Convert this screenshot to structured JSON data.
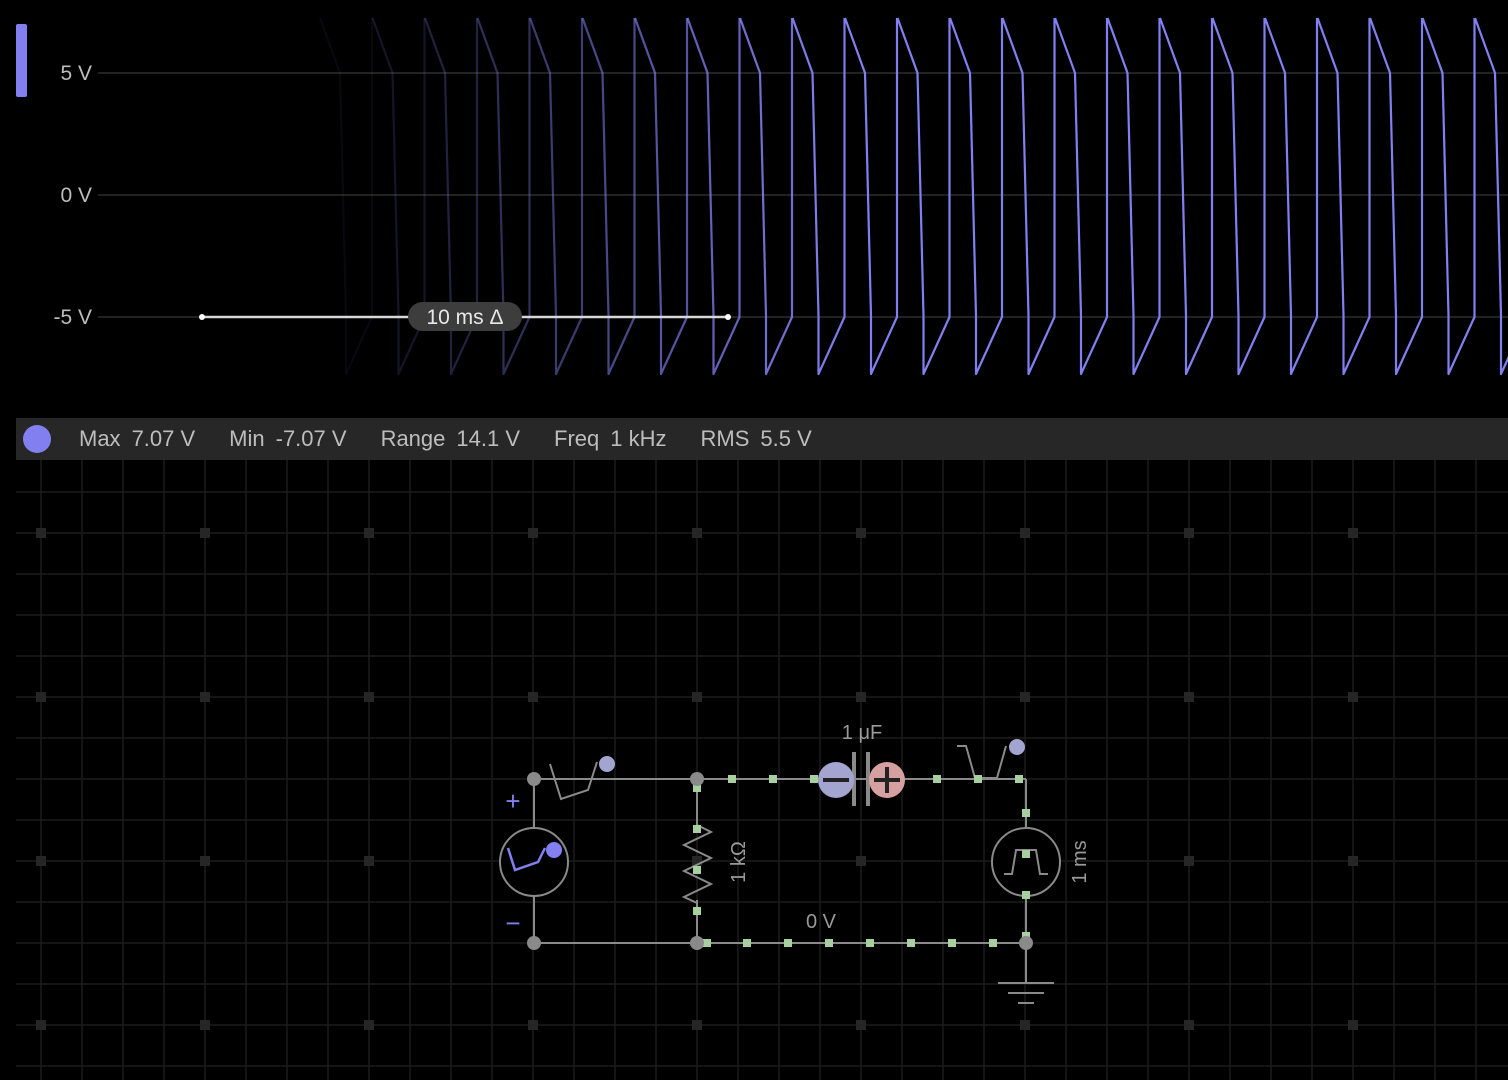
{
  "scope": {
    "y_axis": {
      "ticks": [
        "5 V",
        "0 V",
        "-5 V"
      ]
    },
    "time_marker": {
      "label": "10 ms Δ"
    },
    "trace_color": "#8280f0"
  },
  "stats": {
    "max": {
      "label": "Max",
      "value": "7.07 V"
    },
    "min": {
      "label": "Min",
      "value": "-7.07 V"
    },
    "range": {
      "label": "Range",
      "value": "14.1 V"
    },
    "freq": {
      "label": "Freq",
      "value": "1 kHz"
    },
    "rms": {
      "label": "RMS",
      "value": "5.5 V"
    }
  },
  "circuit": {
    "capacitor_label": "1 μF",
    "resistor_label": "1 kΩ",
    "pulse_source_label": "1 ms",
    "ground_wire_label": "0 V",
    "source_plus": "+",
    "source_minus": "−",
    "colors": {
      "wire": "#8a8a8a",
      "probe": "#8280f0",
      "current": "#a8cfa0",
      "negative": "#a4a4d0",
      "positive": "#d7a0a0"
    }
  }
}
